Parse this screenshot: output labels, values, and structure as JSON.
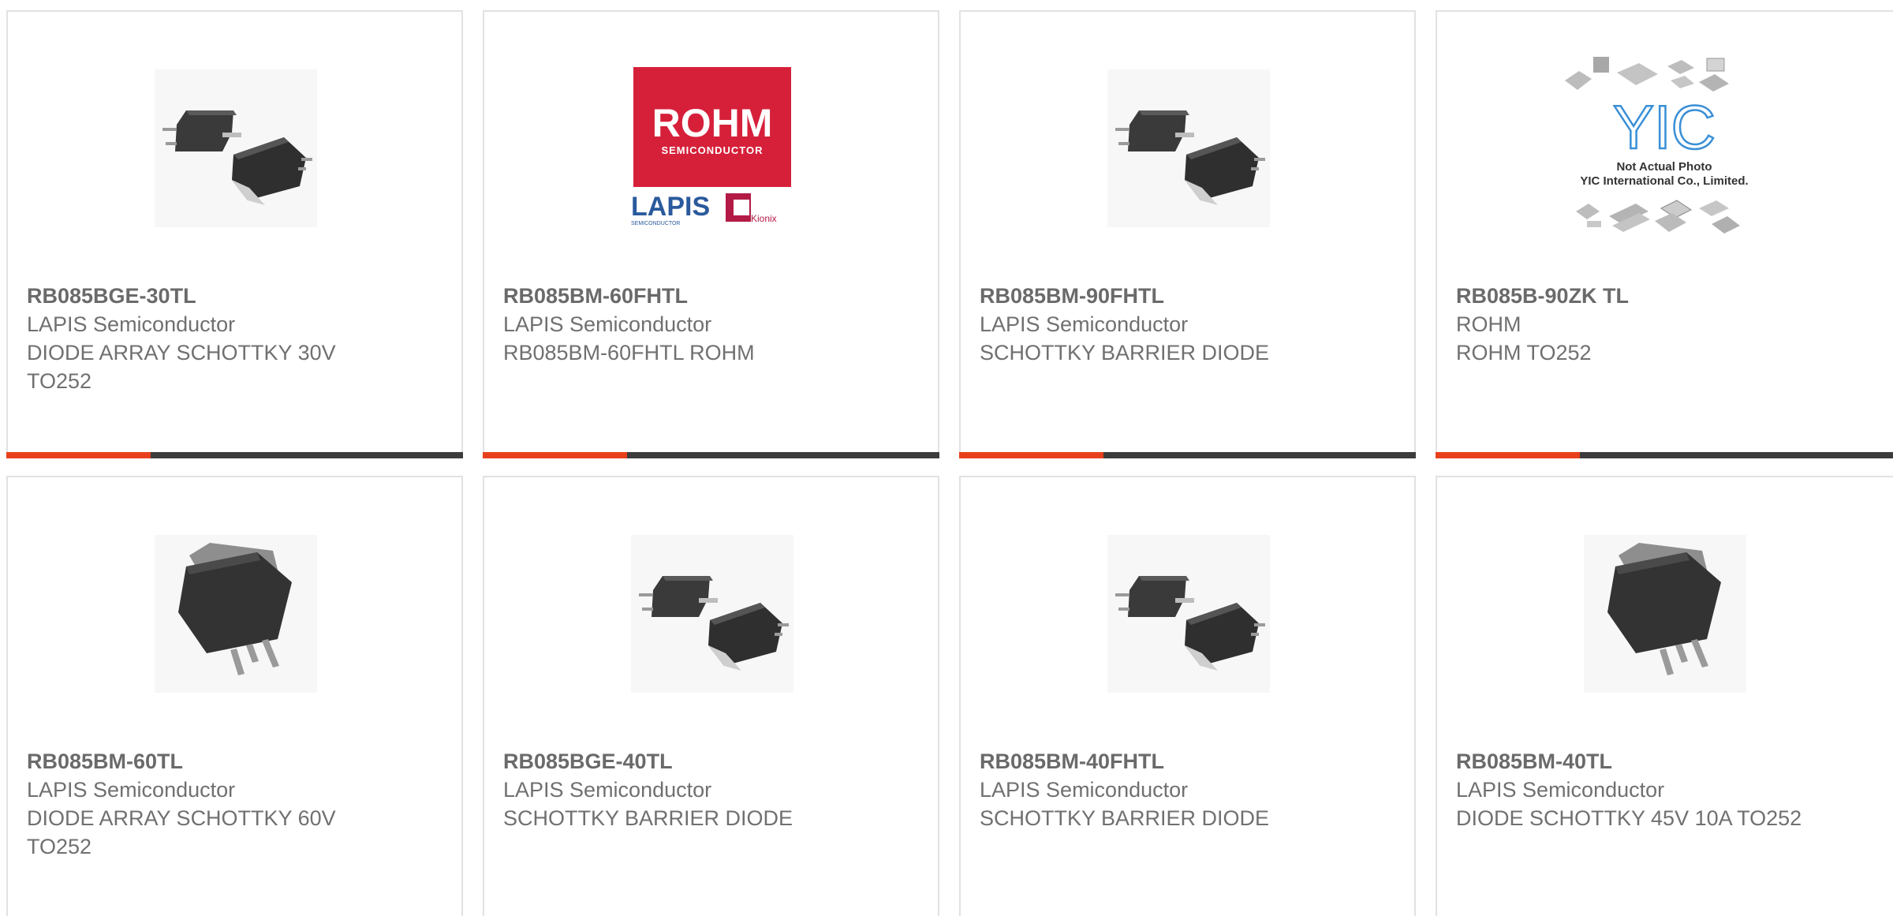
{
  "colors": {
    "accent": "#e8401c",
    "bar": "#3c3c3c",
    "border": "#e2e2e2",
    "text": "#707070",
    "rohm_red": "#d6203a",
    "lapis_blue": "#2a5a9c",
    "yic_blue": "#3a8fd6"
  },
  "products": [
    {
      "part": "RB085BGE-30TL",
      "maker": "LAPIS Semiconductor",
      "desc": "DIODE ARRAY SCHOTTKY 30V TO252",
      "image": "to252-pair-icon"
    },
    {
      "part": "RB085BM-60FHTL",
      "maker": "LAPIS Semiconductor",
      "desc": "RB085BM-60FHTL ROHM",
      "image": "rohm-lapis-logo",
      "logo": {
        "rohm": "ROHM",
        "semiconductor": "SEMICONDUCTOR",
        "lapis": "LAPIS",
        "lapis_sub": "SEMICONDUCTOR",
        "kionix": "Kionix"
      }
    },
    {
      "part": "RB085BM-90FHTL",
      "maker": "LAPIS Semiconductor",
      "desc": "SCHOTTKY BARRIER DIODE",
      "image": "to252-pair-icon"
    },
    {
      "part": "RB085B-90ZK TL",
      "maker": "ROHM",
      "desc": "ROHM TO252",
      "image": "yic-placeholder-icon",
      "placeholder": {
        "logo": "YIC",
        "line1": "Not Actual Photo",
        "line2": "YIC International Co., Limited."
      }
    },
    {
      "part": "RB085BM-60TL",
      "maker": "LAPIS Semiconductor",
      "desc": "DIODE ARRAY SCHOTTKY 60V TO252",
      "image": "to252-single-icon"
    },
    {
      "part": "RB085BGE-40TL",
      "maker": "LAPIS Semiconductor",
      "desc": "SCHOTTKY BARRIER DIODE",
      "image": "to252-pair-icon"
    },
    {
      "part": "RB085BM-40FHTL",
      "maker": "LAPIS Semiconductor",
      "desc": "SCHOTTKY BARRIER DIODE",
      "image": "to252-pair-icon"
    },
    {
      "part": "RB085BM-40TL",
      "maker": "LAPIS Semiconductor",
      "desc": "DIODE SCHOTTKY 45V 10A TO252",
      "image": "to252-single-icon"
    }
  ]
}
